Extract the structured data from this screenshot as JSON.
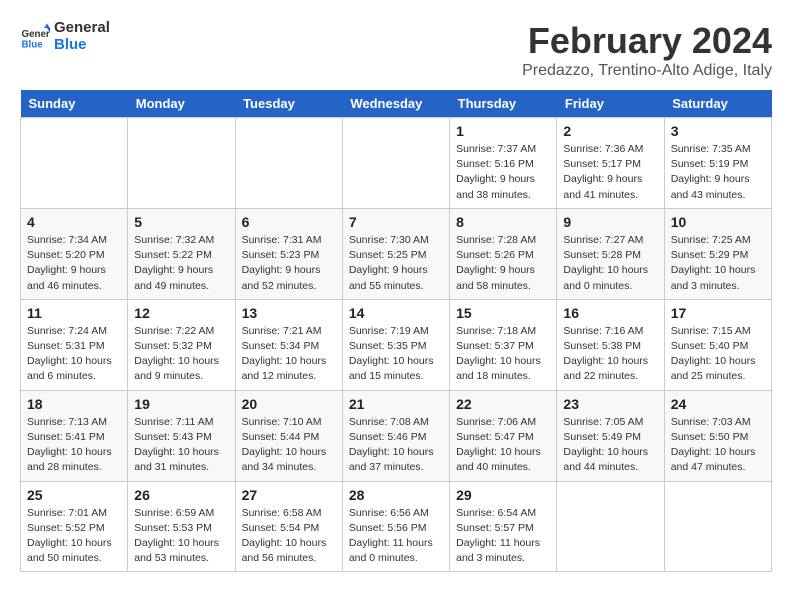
{
  "header": {
    "logo_general": "General",
    "logo_blue": "Blue",
    "month_year": "February 2024",
    "location": "Predazzo, Trentino-Alto Adige, Italy"
  },
  "days": [
    "Sunday",
    "Monday",
    "Tuesday",
    "Wednesday",
    "Thursday",
    "Friday",
    "Saturday"
  ],
  "weeks": [
    [
      {
        "date": "",
        "info": ""
      },
      {
        "date": "",
        "info": ""
      },
      {
        "date": "",
        "info": ""
      },
      {
        "date": "",
        "info": ""
      },
      {
        "date": "1",
        "info": "Sunrise: 7:37 AM\nSunset: 5:16 PM\nDaylight: 9 hours\nand 38 minutes."
      },
      {
        "date": "2",
        "info": "Sunrise: 7:36 AM\nSunset: 5:17 PM\nDaylight: 9 hours\nand 41 minutes."
      },
      {
        "date": "3",
        "info": "Sunrise: 7:35 AM\nSunset: 5:19 PM\nDaylight: 9 hours\nand 43 minutes."
      }
    ],
    [
      {
        "date": "4",
        "info": "Sunrise: 7:34 AM\nSunset: 5:20 PM\nDaylight: 9 hours\nand 46 minutes."
      },
      {
        "date": "5",
        "info": "Sunrise: 7:32 AM\nSunset: 5:22 PM\nDaylight: 9 hours\nand 49 minutes."
      },
      {
        "date": "6",
        "info": "Sunrise: 7:31 AM\nSunset: 5:23 PM\nDaylight: 9 hours\nand 52 minutes."
      },
      {
        "date": "7",
        "info": "Sunrise: 7:30 AM\nSunset: 5:25 PM\nDaylight: 9 hours\nand 55 minutes."
      },
      {
        "date": "8",
        "info": "Sunrise: 7:28 AM\nSunset: 5:26 PM\nDaylight: 9 hours\nand 58 minutes."
      },
      {
        "date": "9",
        "info": "Sunrise: 7:27 AM\nSunset: 5:28 PM\nDaylight: 10 hours\nand 0 minutes."
      },
      {
        "date": "10",
        "info": "Sunrise: 7:25 AM\nSunset: 5:29 PM\nDaylight: 10 hours\nand 3 minutes."
      }
    ],
    [
      {
        "date": "11",
        "info": "Sunrise: 7:24 AM\nSunset: 5:31 PM\nDaylight: 10 hours\nand 6 minutes."
      },
      {
        "date": "12",
        "info": "Sunrise: 7:22 AM\nSunset: 5:32 PM\nDaylight: 10 hours\nand 9 minutes."
      },
      {
        "date": "13",
        "info": "Sunrise: 7:21 AM\nSunset: 5:34 PM\nDaylight: 10 hours\nand 12 minutes."
      },
      {
        "date": "14",
        "info": "Sunrise: 7:19 AM\nSunset: 5:35 PM\nDaylight: 10 hours\nand 15 minutes."
      },
      {
        "date": "15",
        "info": "Sunrise: 7:18 AM\nSunset: 5:37 PM\nDaylight: 10 hours\nand 18 minutes."
      },
      {
        "date": "16",
        "info": "Sunrise: 7:16 AM\nSunset: 5:38 PM\nDaylight: 10 hours\nand 22 minutes."
      },
      {
        "date": "17",
        "info": "Sunrise: 7:15 AM\nSunset: 5:40 PM\nDaylight: 10 hours\nand 25 minutes."
      }
    ],
    [
      {
        "date": "18",
        "info": "Sunrise: 7:13 AM\nSunset: 5:41 PM\nDaylight: 10 hours\nand 28 minutes."
      },
      {
        "date": "19",
        "info": "Sunrise: 7:11 AM\nSunset: 5:43 PM\nDaylight: 10 hours\nand 31 minutes."
      },
      {
        "date": "20",
        "info": "Sunrise: 7:10 AM\nSunset: 5:44 PM\nDaylight: 10 hours\nand 34 minutes."
      },
      {
        "date": "21",
        "info": "Sunrise: 7:08 AM\nSunset: 5:46 PM\nDaylight: 10 hours\nand 37 minutes."
      },
      {
        "date": "22",
        "info": "Sunrise: 7:06 AM\nSunset: 5:47 PM\nDaylight: 10 hours\nand 40 minutes."
      },
      {
        "date": "23",
        "info": "Sunrise: 7:05 AM\nSunset: 5:49 PM\nDaylight: 10 hours\nand 44 minutes."
      },
      {
        "date": "24",
        "info": "Sunrise: 7:03 AM\nSunset: 5:50 PM\nDaylight: 10 hours\nand 47 minutes."
      }
    ],
    [
      {
        "date": "25",
        "info": "Sunrise: 7:01 AM\nSunset: 5:52 PM\nDaylight: 10 hours\nand 50 minutes."
      },
      {
        "date": "26",
        "info": "Sunrise: 6:59 AM\nSunset: 5:53 PM\nDaylight: 10 hours\nand 53 minutes."
      },
      {
        "date": "27",
        "info": "Sunrise: 6:58 AM\nSunset: 5:54 PM\nDaylight: 10 hours\nand 56 minutes."
      },
      {
        "date": "28",
        "info": "Sunrise: 6:56 AM\nSunset: 5:56 PM\nDaylight: 11 hours\nand 0 minutes."
      },
      {
        "date": "29",
        "info": "Sunrise: 6:54 AM\nSunset: 5:57 PM\nDaylight: 11 hours\nand 3 minutes."
      },
      {
        "date": "",
        "info": ""
      },
      {
        "date": "",
        "info": ""
      }
    ]
  ]
}
